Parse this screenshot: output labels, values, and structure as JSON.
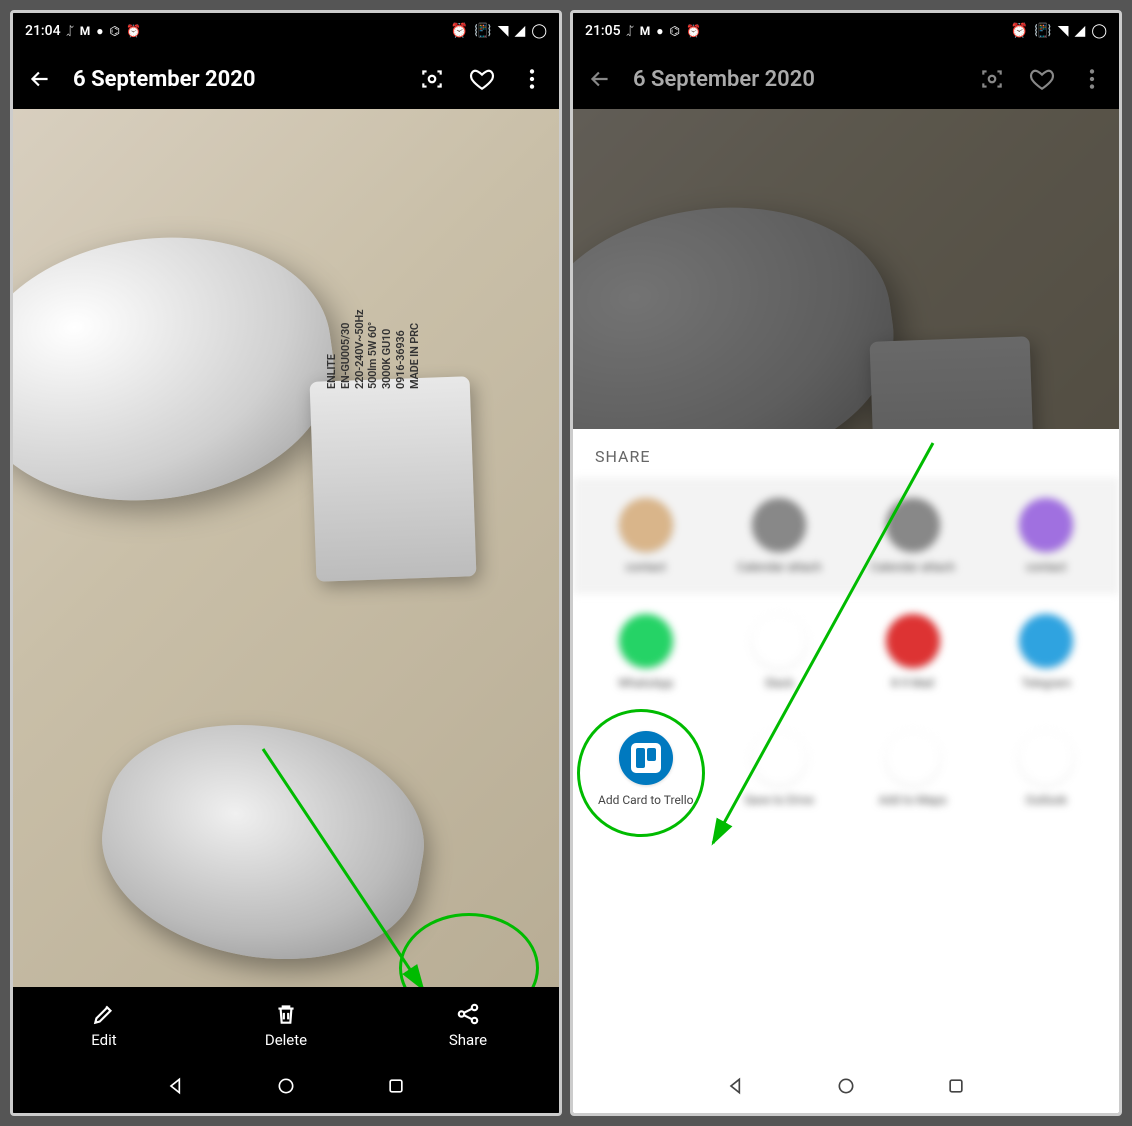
{
  "left": {
    "status": {
      "time": "21:04"
    },
    "title": "6 September 2020",
    "bulb_label": "ENLITE\nEN-GU005/30\n220-240V~50Hz\n500lm 5W 60°\n3000K GU10\n0916-36936\nMADE IN PRC",
    "actions": {
      "edit": "Edit",
      "delete": "Delete",
      "share": "Share"
    }
  },
  "right": {
    "status": {
      "time": "21:05"
    },
    "title": "6 September 2020",
    "share_label": "SHARE",
    "suggested": [
      {
        "label": "contact"
      },
      {
        "label": "Calendar attach"
      },
      {
        "label": "Calendar attach"
      },
      {
        "label": "contact"
      }
    ],
    "apps_row1": [
      {
        "name": "WhatsApp",
        "icon": "whatsapp"
      },
      {
        "name": "Slack",
        "icon": "slack"
      },
      {
        "name": "K-9 Mail",
        "icon": "k9"
      },
      {
        "name": "Telegram",
        "icon": "telegram"
      }
    ],
    "apps_row2": [
      {
        "name": "Add Card to Trello",
        "icon": "trello",
        "highlight": true
      },
      {
        "name": "Save to Drive",
        "icon": "drive"
      },
      {
        "name": "Add to Maps",
        "icon": "maps"
      },
      {
        "name": "Outlook",
        "icon": "outlook"
      }
    ]
  }
}
